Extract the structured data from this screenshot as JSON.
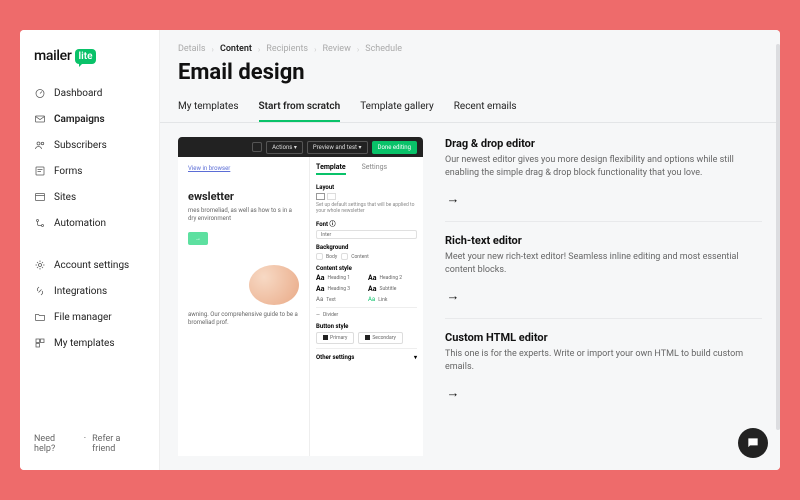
{
  "brand": {
    "word": "mailer",
    "bubble": "lite"
  },
  "nav": {
    "primary": [
      {
        "label": "Dashboard",
        "icon": "dashboard"
      },
      {
        "label": "Campaigns",
        "icon": "mail"
      },
      {
        "label": "Subscribers",
        "icon": "users"
      },
      {
        "label": "Forms",
        "icon": "form"
      },
      {
        "label": "Sites",
        "icon": "globe"
      },
      {
        "label": "Automation",
        "icon": "automation"
      }
    ],
    "secondary": [
      {
        "label": "Account settings",
        "icon": "gear"
      },
      {
        "label": "Integrations",
        "icon": "link"
      },
      {
        "label": "File manager",
        "icon": "folder"
      },
      {
        "label": "My templates",
        "icon": "templates"
      }
    ],
    "active": "Campaigns"
  },
  "footer": {
    "help": "Need help?",
    "refer": "Refer a friend"
  },
  "breadcrumbs": [
    "Details",
    "Content",
    "Recipients",
    "Review",
    "Schedule"
  ],
  "breadcrumb_active": "Content",
  "page_title": "Email design",
  "designer_tabs": [
    "My templates",
    "Start from scratch",
    "Template gallery",
    "Recent emails"
  ],
  "designer_tab_active": "Start from scratch",
  "preview": {
    "view_in_browser": "View in browser",
    "toolbar": {
      "actions": "Actions ▾",
      "preview_test": "Preview and test ▾",
      "done": "Done editing"
    },
    "nl_heading": "ewsletter",
    "nl_body": "mes bromeliad, as well as how to\ns in a dry environment",
    "bottom": "awning. Our comprehensive guide\nto be a bromeliad prof.",
    "right": {
      "tabs": [
        "Template",
        "Settings"
      ],
      "layout_label": "Layout",
      "layout_desc": "Set up default settings that will be applied to your whole newsletter",
      "font_label": "Font ⓘ",
      "font_value": "Inter",
      "bg_label": "Background",
      "bg_body": "Body",
      "bg_content": "Content",
      "cs_label": "Content style",
      "cs_h1": "Heading 1",
      "cs_h2": "Heading 2",
      "cs_h3": "Heading 3",
      "cs_sub": "Subtitle",
      "cs_text": "Text",
      "cs_link": "Link",
      "divider": "Divider",
      "bs_label": "Button style",
      "bs_primary": "Primary",
      "bs_secondary": "Secondary",
      "other": "Other settings"
    }
  },
  "editors": [
    {
      "title": "Drag & drop editor",
      "desc": "Our newest editor gives you more design flexibility and options while still enabling the simple drag & drop block functionality that you love."
    },
    {
      "title": "Rich-text editor",
      "desc": "Meet your new rich-text editor! Seamless inline editing and most essential content blocks."
    },
    {
      "title": "Custom HTML editor",
      "desc": "This one is for the experts. Write or import your own HTML to build custom emails."
    }
  ]
}
